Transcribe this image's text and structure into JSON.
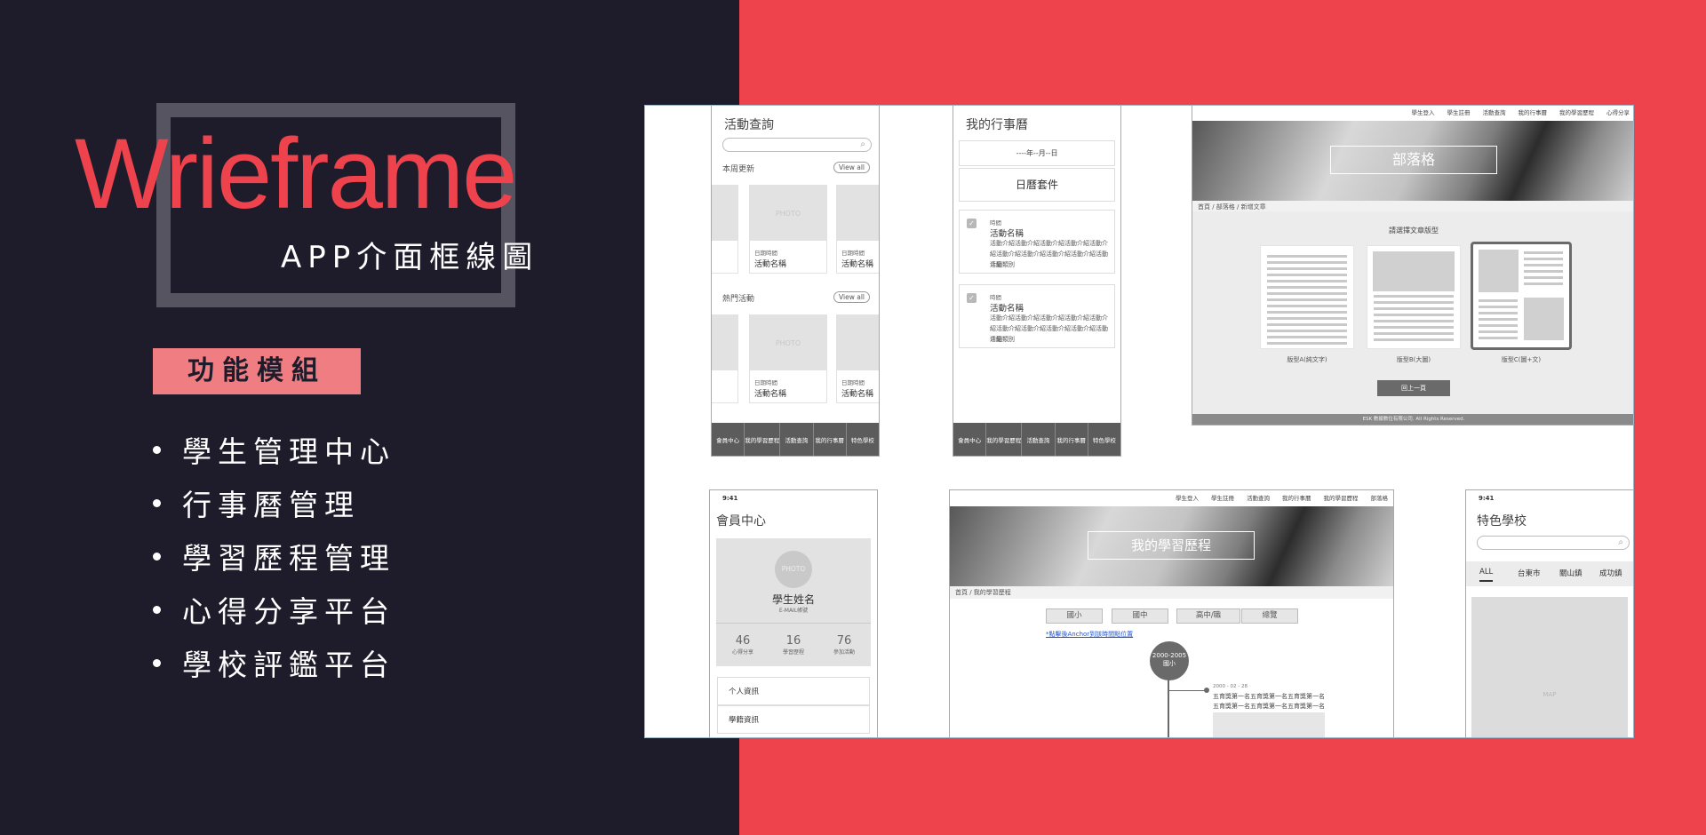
{
  "hero": {
    "title": "Wrieframe",
    "subtitle": "APP介面框線圖",
    "module_label": "功能模組",
    "features": [
      "學生管理中心",
      "行事曆管理",
      "學習歷程管理",
      "心得分享平台",
      "學校評鑑平台"
    ]
  },
  "activity": {
    "title": "活動查詢",
    "section1": "本周更新",
    "section2": "熱門活動",
    "view_all": "View all",
    "photo": "PHOTO",
    "card_date": "日期時間",
    "card_name": "活動名稱",
    "nav": [
      "會員中心",
      "我的學習歷程",
      "活動查詢",
      "我的行事曆",
      "特色學校"
    ]
  },
  "calendar": {
    "title": "我的行事曆",
    "date_select": "----年--月--日",
    "widget": "日曆套件",
    "event_time": "時間",
    "event_name": "活動名稱",
    "event_desc": "活動介紹活動介紹活動介紹活動介紹活動介紹活動介紹活動介紹活動介紹活動介紹活動介紹",
    "event_type": "活動類別"
  },
  "blog": {
    "topnav": [
      "學生登入",
      "學生註冊",
      "活動查詢",
      "我的行事曆",
      "我的學習歷程",
      "心得分享"
    ],
    "hero_title": "部落格",
    "breadcrumb": "首頁 / 部落格 / 新增文章",
    "prompt": "請選擇文章版型",
    "layouts": [
      "版型A(純文字)",
      "版型B(大圖)",
      "版型C(圖+文)"
    ],
    "back_button": "回上一頁",
    "footer": "ESK 數據數位有限公司. All Rights Reserved."
  },
  "member": {
    "time": "9:41",
    "title": "會員中心",
    "photo": "PHOTO",
    "name": "學生姓名",
    "email": "E-MAIL帳號",
    "stats": [
      {
        "value": "46",
        "label": "心得分享"
      },
      {
        "value": "16",
        "label": "學習歷程"
      },
      {
        "value": "76",
        "label": "參加活動"
      }
    ],
    "menu": [
      "个人資訊",
      "學籍資訊"
    ]
  },
  "portfolio": {
    "topnav": [
      "學生登入",
      "學生註冊",
      "活動查詢",
      "我的行事曆",
      "我的學習歷程",
      "部落格"
    ],
    "hero_title": "我的學習歷程",
    "breadcrumb": "首頁 / 我的學習歷程",
    "tags": [
      "國小",
      "國中",
      "高中/職",
      "總覽"
    ],
    "anchor_link": "*點擊後Anchor到該時間點位置",
    "node_years": "2000-2005",
    "node_stage": "國小",
    "entry_date": "2000 - 02 - 28",
    "entry_text": "五育獎第一名五育獎第一名五育獎第一名五育獎第一名五育獎第一名五育獎第一名"
  },
  "schools": {
    "time": "9:41",
    "title": "特色學校",
    "tabs": [
      "ALL",
      "台東市",
      "關山鎮",
      "成功鎮"
    ],
    "map": "MAP"
  }
}
